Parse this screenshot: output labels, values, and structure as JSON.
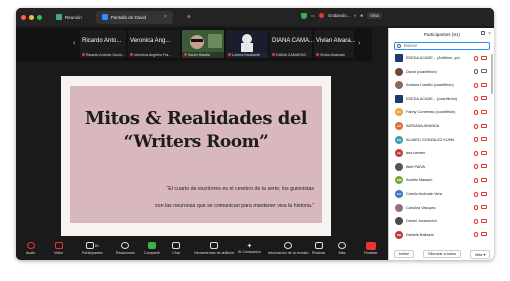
{
  "tabs": [
    {
      "label": "Reunión",
      "active": false
    },
    {
      "label": "Pantalla de David",
      "active": true
    }
  ],
  "topbar": {
    "recording_label": "Grabando...",
    "view_label": "Vista"
  },
  "strip": [
    {
      "name": "Ricardo Anto...",
      "sub": "Ricardo Antonio Guzm..."
    },
    {
      "name": "Veronica Ang...",
      "sub": "Veronica Angeles Fra..."
    },
    {
      "name": "",
      "sub": "Saulin Batalla"
    },
    {
      "name": "",
      "sub": "Lorena Escalante"
    },
    {
      "name": "DIANA CAMA...",
      "sub": "DIANA CAMARGO"
    },
    {
      "name": "Vivian Alvara...",
      "sub": "Vivian Alvarado"
    }
  ],
  "slide": {
    "title_line1": "Mitos & Realidades del",
    "title_line2": "“Writers Room”",
    "body_line1": "“El cuarto de escritores es el cerebro de la serie; los guionistas",
    "body_line2": "son las neuronas que se comunican para mantener viva la historia.”"
  },
  "toolbar": {
    "audio": "Audio",
    "video": "Video",
    "participants": "Participantes",
    "participants_count": "81",
    "reactions": "Reacciones",
    "share": "Compartir",
    "chat": "Chat",
    "apps": "Herramientas de anfitrión",
    "ai": "AI Companion",
    "info": "Información de la reunión",
    "whiteboards": "Pizarras",
    "more": "Más",
    "end": "Finalizar"
  },
  "panel": {
    "title": "Participantes (81)",
    "search_placeholder": "Buscar",
    "participants": [
      {
        "name": "EDEDA ACADE... (Anfitrión, yo)",
        "initials": "",
        "color": "#1a3a6e",
        "square": true,
        "mic_on": false,
        "cam_on": false
      },
      {
        "name": "David (coanfitrión)",
        "initials": "",
        "color": "#6b4a3a",
        "square": false,
        "mic_on": true,
        "cam_on": true
      },
      {
        "name": "Adriana Castillo (coanfitrión)",
        "initials": "",
        "color": "#8a6a5a",
        "square": false,
        "mic_on": false,
        "cam_on": false
      },
      {
        "name": "EDEDA ACADE... (coanfitrión)",
        "initials": "",
        "color": "#1a3a6e",
        "square": true,
        "mic_on": false,
        "cam_on": false
      },
      {
        "name": "Fanny Contreras (coanfitrión)",
        "initials": "FC",
        "color": "#e8a33d",
        "square": false,
        "mic_on": false,
        "cam_on": false
      },
      {
        "name": "ADRIANA ARANDA",
        "initials": "AA",
        "color": "#e06c3a",
        "square": false,
        "mic_on": false,
        "cam_on": false
      },
      {
        "name": "ALVARO GONZALEZ KUHN",
        "initials": "AG",
        "color": "#3aa0a8",
        "square": false,
        "mic_on": false,
        "cam_on": false
      },
      {
        "name": "ana barreto",
        "initials": "ab",
        "color": "#c04040",
        "square": false,
        "mic_on": false,
        "cam_on": false
      },
      {
        "name": "Ailet PAIVA",
        "initials": "",
        "color": "#555555",
        "square": false,
        "mic_on": false,
        "cam_on": false
      },
      {
        "name": "Andrés Massuh",
        "initials": "AM",
        "color": "#7aa83a",
        "square": false,
        "mic_on": false,
        "cam_on": false
      },
      {
        "name": "Camilo Andrade Vera",
        "initials": "CA",
        "color": "#3a7ac0",
        "square": false,
        "mic_on": false,
        "cam_on": false
      },
      {
        "name": "Carolina Vasquez",
        "initials": "",
        "color": "#9a6a8a",
        "square": false,
        "mic_on": false,
        "cam_on": false
      },
      {
        "name": "Daniel Jovanovich",
        "initials": "",
        "color": "#4a4a4a",
        "square": false,
        "mic_on": false,
        "cam_on": false
      },
      {
        "name": "Daniela Baltazar",
        "initials": "DB",
        "color": "#c03a3a",
        "square": false,
        "mic_on": false,
        "cam_on": false
      }
    ],
    "invite_label": "Invitar",
    "mute_all_label": "Silenciar a todos",
    "more_label": "Más"
  }
}
